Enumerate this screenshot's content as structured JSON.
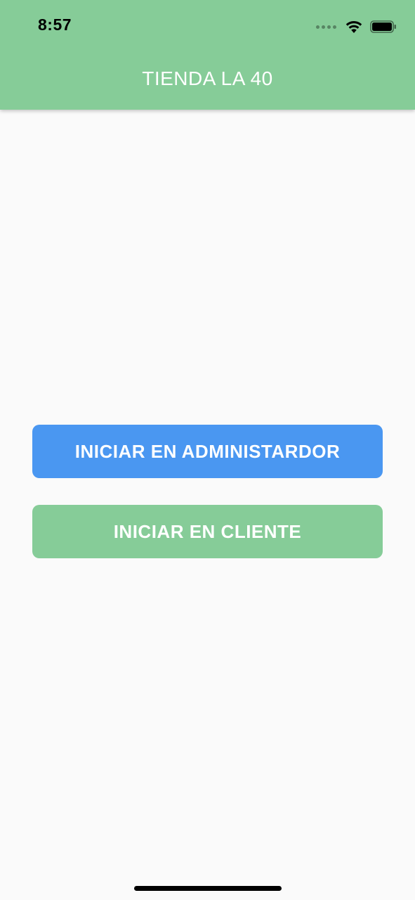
{
  "status_bar": {
    "time": "8:57",
    "icons": [
      "signal-dots-icon",
      "wifi-icon",
      "battery-icon"
    ]
  },
  "app_bar": {
    "title": "TIENDA LA 40"
  },
  "buttons": {
    "admin_label": "INICIAR EN ADMINISTARDOR",
    "client_label": "INICIAR EN CLIENTE"
  },
  "colors": {
    "app_bar": "#86cc98",
    "admin_button": "#4a97f1",
    "client_button": "#86cc98",
    "background": "#fafafa"
  }
}
